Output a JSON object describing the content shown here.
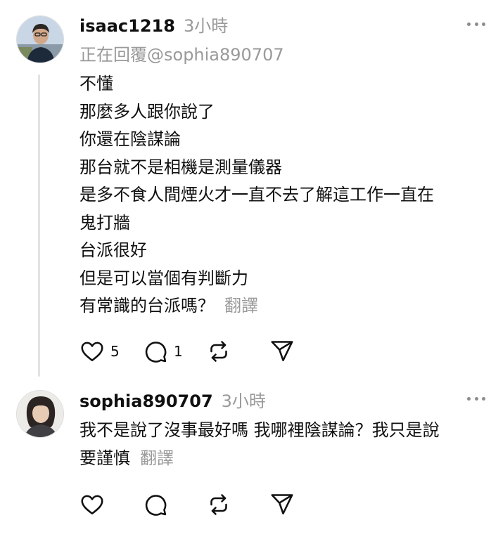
{
  "posts": [
    {
      "username": "isaac1218",
      "time": "3小時",
      "replying_prefix": "正在回覆",
      "replying_to": "@sophia890707",
      "lines": [
        "不懂",
        "那麼多人跟你說了",
        "你還在陰謀論",
        "那台就不是相機是測量儀器",
        "是多不食人間煙火才一直不去了解這工作一直在",
        "鬼打牆",
        "台派很好",
        "但是可以當個有判斷力",
        "有常識的台派嗎？"
      ],
      "translate_label": "翻譯",
      "like_count": "5",
      "comment_count": "1"
    },
    {
      "username": "sophia890707",
      "time": "3小時",
      "lines": [
        "我不是說了沒事最好嗎 我哪裡陰謀論？我只是說",
        "要謹慎"
      ],
      "translate_label": "翻譯",
      "like_count": "",
      "comment_count": ""
    }
  ],
  "icons": {
    "like": "heart-icon",
    "comment": "comment-bubble-icon",
    "repost": "repost-icon",
    "share": "send-icon",
    "more": "more-dots-icon"
  },
  "colors": {
    "text": "#101010",
    "secondary": "#9a9a9a",
    "thread_line": "#e3e3e3"
  }
}
